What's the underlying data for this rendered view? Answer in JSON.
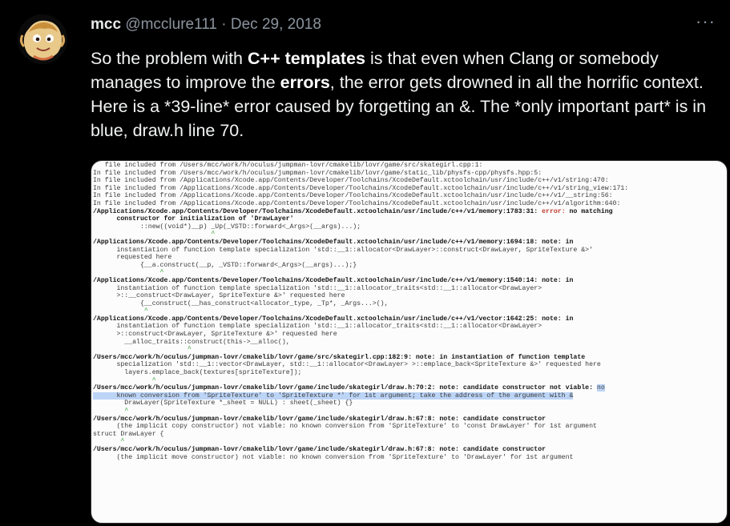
{
  "tweet": {
    "author_name": "mcc",
    "handle": "@mcclure111",
    "separator": "·",
    "date": "Dec 29, 2018",
    "more": "···",
    "text": [
      {
        "t": "So the problem with ",
        "b": false
      },
      {
        "t": "C++",
        "b": true
      },
      {
        "t": " ",
        "b": false
      },
      {
        "t": "templates",
        "b": true
      },
      {
        "t": " is that even when Clang or somebody manages to improve the ",
        "b": false
      },
      {
        "t": "errors",
        "b": true
      },
      {
        "t": ", the error gets drowned in all the horrific context. Here is a *39-line* error caused by forgetting an &. The *only important part* is in blue, draw.h line 70.",
        "b": false
      }
    ]
  },
  "code_lines": [
    {
      "t": "   file included from /Users/mcc/work/h/oculus/jumpman-lovr/cmakelib/lovr/game/src/skategirl.cpp:1:"
    },
    {
      "t": "In file included from /Users/mcc/work/h/oculus/jumpman-lovr/cmakelib/lovr/game/static_lib/physfs-cpp/physfs.hpp:5:"
    },
    {
      "t": "In file included from /Applications/Xcode.app/Contents/Developer/Toolchains/XcodeDefault.xctoolchain/usr/include/c++/v1/string:470:"
    },
    {
      "t": "In file included from /Applications/Xcode.app/Contents/Developer/Toolchains/XcodeDefault.xctoolchain/usr/include/c++/v1/string_view:171:"
    },
    {
      "t": "In file included from /Applications/Xcode.app/Contents/Developer/Toolchains/XcodeDefault.xctoolchain/usr/include/c++/v1/__string:56:"
    },
    {
      "t": "In file included from /Applications/Xcode.app/Contents/Developer/Toolchains/XcodeDefault.xctoolchain/usr/include/c++/v1/algorithm:640:"
    },
    {
      "t": "/Applications/Xcode.app/Contents/Developer/Toolchains/XcodeDefault.xctoolchain/usr/include/c++/v1/memory:1783:31: ",
      "b": true,
      "e": "error:",
      "r": " no matching"
    },
    {
      "t": "      constructor for initialization of 'DrawLayer'",
      "b": true
    },
    {
      "t": "            ::new((void*)__p) _Up(_VSTD::forward<_Args>(__args)...);"
    },
    {
      "t": "                              ^",
      "c": true
    },
    {
      "t": "/Applications/Xcode.app/Contents/Developer/Toolchains/XcodeDefault.xctoolchain/usr/include/c++/v1/memory:1694:18: note: in",
      "b": true
    },
    {
      "t": "      instantiation of function template specialization 'std::__1::allocator<DrawLayer>::construct<DrawLayer, SpriteTexture &>'"
    },
    {
      "t": "      requested here"
    },
    {
      "t": "            {__a.construct(__p, _VSTD::forward<_Args>(__args)...);}"
    },
    {
      "t": "                 ^",
      "c": true
    },
    {
      "t": "/Applications/Xcode.app/Contents/Developer/Toolchains/XcodeDefault.xctoolchain/usr/include/c++/v1/memory:1540:14: note: in",
      "b": true
    },
    {
      "t": "      instantiation of function template specialization 'std::__1::allocator_traits<std::__1::allocator<DrawLayer>"
    },
    {
      "t": "      >::__construct<DrawLayer, SpriteTexture &>' requested here"
    },
    {
      "t": "            {__construct(__has_construct<allocator_type, _Tp*, _Args...>(),"
    },
    {
      "t": "             ^",
      "c": true
    },
    {
      "t": "/Applications/Xcode.app/Contents/Developer/Toolchains/XcodeDefault.xctoolchain/usr/include/c++/v1/vector:1642:25: note: in",
      "b": true
    },
    {
      "t": "      instantiation of function template specialization 'std::__1::allocator_traits<std::__1::allocator<DrawLayer>"
    },
    {
      "t": "      >::construct<DrawLayer, SpriteTexture &>' requested here"
    },
    {
      "t": "        __alloc_traits::construct(this->__alloc(),"
    },
    {
      "t": "                        ^",
      "c": true
    },
    {
      "t": "/Users/mcc/work/h/oculus/jumpman-lovr/cmakelib/lovr/game/src/skategirl.cpp:182:9: note: in instantiation of function template",
      "b": true
    },
    {
      "t": "      specialization 'std::__1::vector<DrawLayer, std::__1::allocator<DrawLayer> >::emplace_back<SpriteTexture &>' requested here"
    },
    {
      "t": "        layers.emplace_back(textures[spriteTexture]);"
    },
    {
      "t": "               ^",
      "c": true
    },
    {
      "t": "/Users/mcc/work/h/oculus/jumpman-lovr/cmakelib/lovr/game/include/skategirl/draw.h:70:2: note: candidate constructor not viable: ",
      "b": true,
      "h": "no",
      "hl": true
    },
    {
      "t": "      known conversion from 'SpriteTexture' to 'SpriteTexture *' for 1st argument; take the address of the argument with &",
      "hl": true
    },
    {
      "t": "        DrawLayer(SpriteTexture *_sheet = NULL) : sheet(_sheet) {}"
    },
    {
      "t": "        ^",
      "c": true
    },
    {
      "t": "/Users/mcc/work/h/oculus/jumpman-lovr/cmakelib/lovr/game/include/skategirl/draw.h:67:8: note: candidate constructor",
      "b": true
    },
    {
      "t": "      (the implicit copy constructor) not viable: no known conversion from 'SpriteTexture' to 'const DrawLayer' for 1st argument"
    },
    {
      "t": "struct DrawLayer {"
    },
    {
      "t": "       ^",
      "c": true
    },
    {
      "t": "/Users/mcc/work/h/oculus/jumpman-lovr/cmakelib/lovr/game/include/skategirl/draw.h:67:8: note: candidate constructor",
      "b": true
    },
    {
      "t": "      (the implicit move constructor) not viable: no known conversion from 'SpriteTexture' to 'DrawLayer' for 1st argument"
    }
  ]
}
